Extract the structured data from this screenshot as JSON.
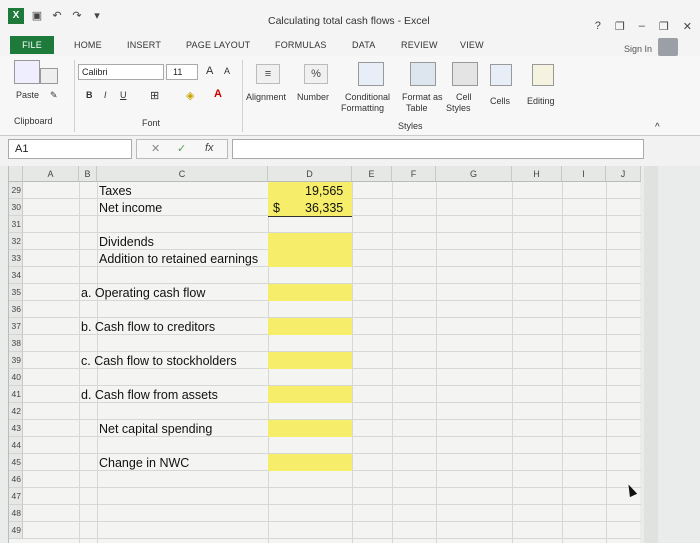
{
  "window": {
    "title": "Calculating total cash flows - Excel",
    "help": "?",
    "minimize": "–",
    "restore": "❐",
    "close": "✕"
  },
  "tabs": [
    "FILE",
    "HOME",
    "INSERT",
    "PAGE LAYOUT",
    "FORMULAS",
    "DATA",
    "REVIEW",
    "VIEW"
  ],
  "account": {
    "sign_in": "Sign In"
  },
  "ribbon": {
    "paste": "Paste",
    "clipboard": "Clipboard",
    "font_name": "Calibri",
    "font_size": "11",
    "grow_font": "A",
    "shrink_font": "A",
    "bold": "B",
    "italic": "I",
    "underline": "U",
    "font_group": "Font",
    "alignment": "Alignment",
    "number": "Number",
    "number_icon": "%",
    "conditional_formatting": [
      "Conditional",
      "Formatting"
    ],
    "format_as_table": [
      "Format as",
      "Table"
    ],
    "cell_styles": [
      "Cell",
      "Styles"
    ],
    "styles_group": "Styles",
    "cells": "Cells",
    "editing": "Editing"
  },
  "formula_bar": {
    "name_box": "A1",
    "fx": "fx",
    "cancel": "✕",
    "enter": "✓",
    "value": ""
  },
  "columns": [
    "A",
    "B",
    "C",
    "D",
    "E",
    "F",
    "G",
    "H",
    "I",
    "J"
  ],
  "rows": [
    "29",
    "30",
    "31",
    "32",
    "33",
    "34",
    "35",
    "36",
    "37",
    "38",
    "39",
    "40",
    "41",
    "42",
    "43",
    "44",
    "45",
    "46",
    "47",
    "48",
    "49"
  ],
  "cells": {
    "taxes": "Taxes",
    "taxes_value": "19,565",
    "net_income": "Net income",
    "net_income_currency": "$",
    "net_income_value": "36,335",
    "dividends": "Dividends",
    "retained": "Addition to retained earnings",
    "ocf": "a. Operating cash flow",
    "cfc": "b. Cash flow to creditors",
    "cfs": "c. Cash flow to stockholders",
    "cfa": "d. Cash flow from assets",
    "ncs": "Net capital spending",
    "nwc": "Change in NWC"
  },
  "colors": {
    "excel_green": "#1d7a3a",
    "input_yellow": "#f6ee6a"
  }
}
